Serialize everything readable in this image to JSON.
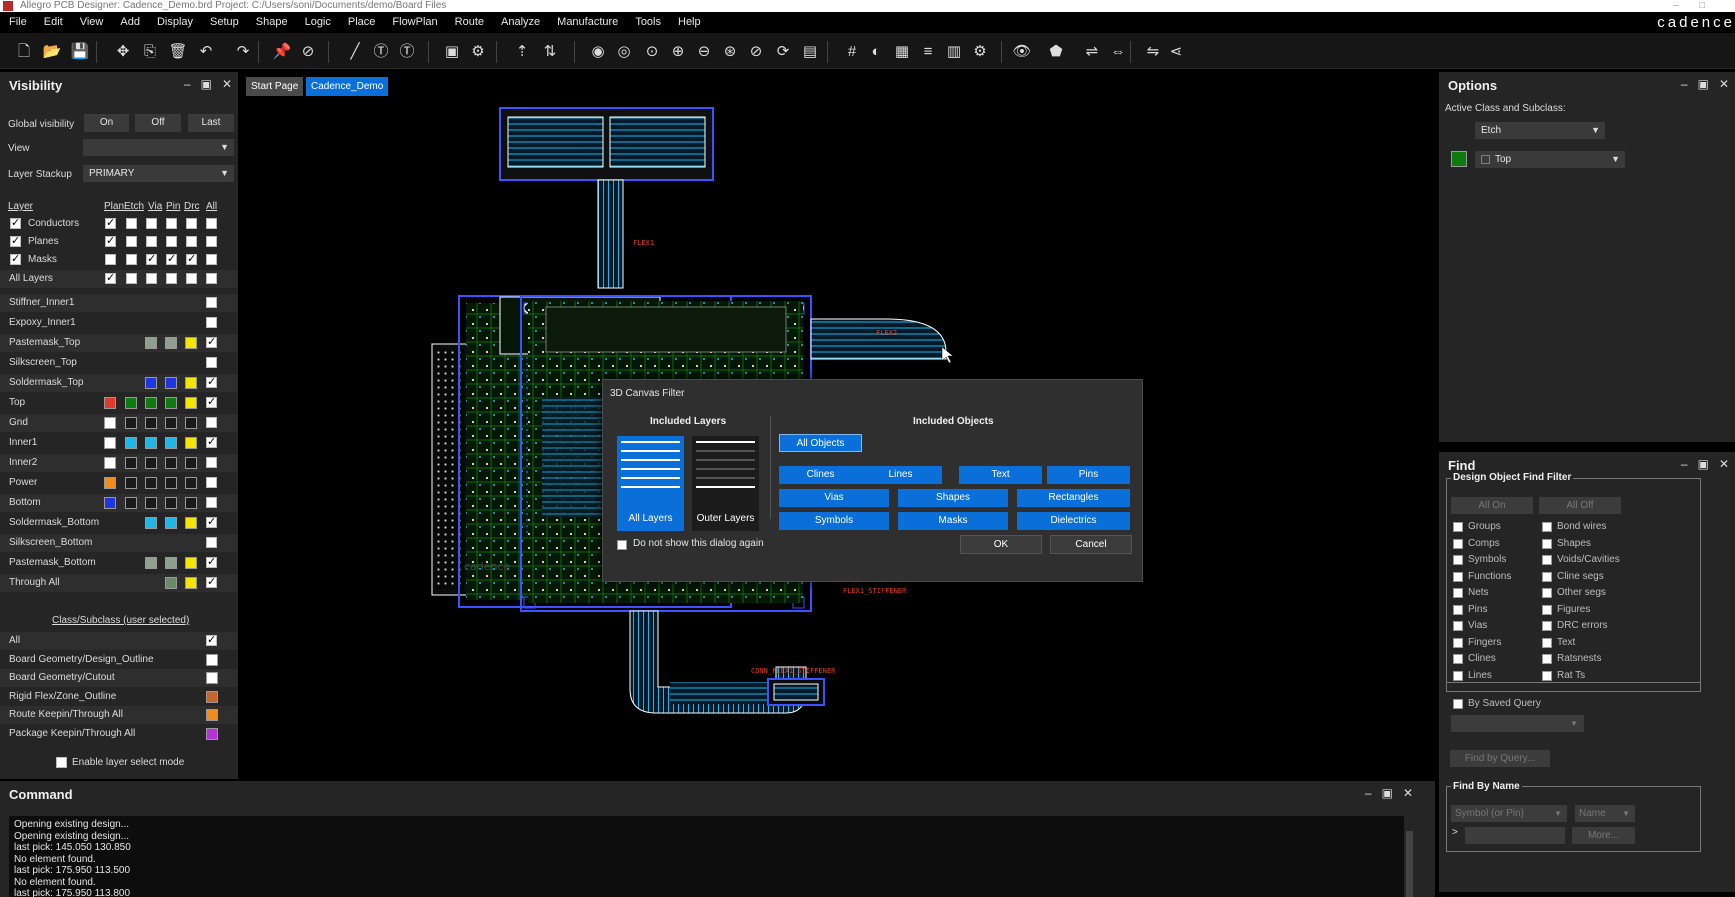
{
  "window": {
    "title": "Allegro PCB Designer: Cadence_Demo.brd  Project: C:/Users/soni/Documents/demo/Board Files",
    "brand": "cadence"
  },
  "menu": [
    "File",
    "Edit",
    "View",
    "Add",
    "Display",
    "Setup",
    "Shape",
    "Logic",
    "Place",
    "FlowPlan",
    "Route",
    "Analyze",
    "Manufacture",
    "Tools",
    "Help"
  ],
  "toolbar": {
    "icons": [
      "new-file-icon",
      "open-folder-icon",
      "save-icon",
      "move-icon",
      "copy-icon",
      "delete-icon",
      "undo-icon",
      "redo-icon",
      "pin-icon",
      "unpin-icon",
      "add-connect-icon",
      "text-icon",
      "edit-text-icon",
      "place-icon",
      "component-icon",
      "slide-icon",
      "spread-icon",
      "drc-icon",
      "color-icon",
      "zoom-fit-icon",
      "zoom-in-icon",
      "zoom-out-icon",
      "zoom-world-icon",
      "zoom-previous-icon",
      "redraw-icon",
      "3d-view-icon",
      "grid-icon",
      "color-wheel-icon",
      "layers-icon",
      "stackup-icon",
      "report-icon",
      "settings-icon",
      "visibility-eye-icon",
      "shape-icon",
      "fanout-icon",
      "measure-icon",
      "flip-icon",
      "share-icon"
    ]
  },
  "visibility": {
    "title": "Visibility",
    "global_label": "Global visibility",
    "global_buttons": [
      "On",
      "Off",
      "Last"
    ],
    "view_label": "View",
    "view_value": "",
    "stackup_label": "Layer Stackup",
    "stackup_value": "PRIMARY",
    "columns": [
      "Layer",
      "Plan",
      "Etch",
      "Via",
      "Pin",
      "Drc",
      "All"
    ],
    "groups": [
      {
        "name": "Conductors",
        "checks": [
          true,
          true,
          false,
          false,
          false,
          false,
          false
        ]
      },
      {
        "name": "Planes",
        "checks": [
          true,
          true,
          false,
          false,
          false,
          false,
          false
        ]
      },
      {
        "name": "Masks",
        "checks": [
          true,
          false,
          false,
          true,
          true,
          true,
          false
        ]
      }
    ],
    "all_layers": {
      "name": "All Layers",
      "checks": [
        true,
        false,
        false,
        false,
        false,
        false
      ]
    },
    "layers": [
      {
        "name": "Stiffner_Inner1",
        "swatches": [],
        "all": false
      },
      {
        "name": "Expoxy_Inner1",
        "swatches": [],
        "all": false
      },
      {
        "name": "Pastemask_Top",
        "swatches": [
          "#8fa08f",
          "#8fa08f",
          "#f5e600"
        ],
        "all": true
      },
      {
        "name": "Silkscreen_Top",
        "swatches": [],
        "all": false
      },
      {
        "name": "Soldermask_Top",
        "swatches": [
          "#1f36e0",
          "#1f36e0",
          "#f5e600"
        ],
        "all": true
      },
      {
        "name": "Top",
        "swatches": [
          "#e03a2a",
          "#0f7a0f",
          "#0f7a0f",
          "#0f7a0f",
          "#f5e600"
        ],
        "all": true
      },
      {
        "name": "Gnd",
        "swatches": [
          "#ffffff",
          "#1a1a1a",
          "#1a1a1a",
          "#1a1a1a",
          "#1a1a1a"
        ],
        "all": false
      },
      {
        "name": "Inner1",
        "swatches": [
          "#ffffff",
          "#21b6e8",
          "#21b6e8",
          "#21b6e8",
          "#f5e600"
        ],
        "all": true
      },
      {
        "name": "Inner2",
        "swatches": [
          "#ffffff",
          "#1a1a1a",
          "#1a1a1a",
          "#1a1a1a",
          "#1a1a1a"
        ],
        "all": false
      },
      {
        "name": "Power",
        "swatches": [
          "#f08b1e",
          "#1a1a1a",
          "#1a1a1a",
          "#1a1a1a",
          "#1a1a1a"
        ],
        "all": false
      },
      {
        "name": "Bottom",
        "swatches": [
          "#1f36e0",
          "#1a1a1a",
          "#1a1a1a",
          "#1a1a1a",
          "#1a1a1a"
        ],
        "all": false
      },
      {
        "name": "Soldermask_Bottom",
        "swatches": [
          "#21b6e8",
          "#21b6e8",
          "#f5e600"
        ],
        "all": true
      },
      {
        "name": "Silkscreen_Bottom",
        "swatches": [],
        "all": false
      },
      {
        "name": "Pastemask_Bottom",
        "swatches": [
          "#8fa08f",
          "#8fa08f",
          "#f5e600"
        ],
        "all": true
      },
      {
        "name": "Through All",
        "swatches": [
          "#6a8a6a",
          "#f5e600"
        ],
        "all": true
      }
    ],
    "class_header": "Class/Subclass (user selected)",
    "class_rows": [
      {
        "name": "All",
        "color": "#ffffff",
        "checked": true
      },
      {
        "name": "Board Geometry/Design_Outline",
        "color": "#ffffff",
        "checked": false
      },
      {
        "name": "Board Geometry/Cutout",
        "color": "#ffffff",
        "checked": false
      },
      {
        "name": "Rigid Flex/Zone_Outline",
        "color": "#c8652a",
        "checked": false
      },
      {
        "name": "Route Keepin/Through All",
        "color": "#f08b1e",
        "checked": false
      },
      {
        "name": "Package Keepin/Through All",
        "color": "#b531d8",
        "checked": false
      }
    ],
    "enable_layer_select": "Enable layer select mode"
  },
  "tabs": [
    "Start Page",
    "Cadence_Demo"
  ],
  "canvas_labels": {
    "flex_top": "FLEX1",
    "flex_right": "FLEX2",
    "stiffener_right": "FLEX1_STIFFENER",
    "conn_stiffener": "CONN_FLEX1_STIFFENER",
    "board_mark": "cadence"
  },
  "dialog": {
    "title": "3D Canvas Filter",
    "layers_header": "Included Layers",
    "objects_header": "Included Objects",
    "tile_all": "All Layers",
    "tile_outer": "Outer Layers",
    "all_objects": "All Objects",
    "object_buttons": [
      "Clines",
      "Lines",
      "Text",
      "Pins",
      "Vias",
      "Shapes",
      "Rectangles",
      "Symbols",
      "Masks",
      "Dielectrics"
    ],
    "dont_show": "Do not show this dialog again",
    "ok": "OK",
    "cancel": "Cancel"
  },
  "options": {
    "title": "Options",
    "active_label": "Active Class and Subclass:",
    "class_value": "Etch",
    "subclass_value": "Top",
    "subclass_color": "#0f7a0f"
  },
  "find": {
    "title": "Find",
    "group_title": "Design Object Find Filter",
    "all_on": "All On",
    "all_off": "All Off",
    "left": [
      "Groups",
      "Comps",
      "Symbols",
      "Functions",
      "Nets",
      "Pins",
      "Vias",
      "Fingers",
      "Clines",
      "Lines"
    ],
    "right": [
      "Bond wires",
      "Shapes",
      "Voids/Cavities",
      "Cline segs",
      "Other segs",
      "Figures",
      "DRC errors",
      "Text",
      "Ratsnests",
      "Rat Ts"
    ],
    "saved_query": "By Saved Query",
    "find_by_query": "Find by Query...",
    "by_name_title": "Find By Name",
    "name_type": "Symbol (or Pin)",
    "name_mode": "Name",
    "more": "More..."
  },
  "command": {
    "title": "Command",
    "lines": [
      "Opening existing design...",
      "Opening existing design...",
      "last pick:  145.050 130.850",
      "No element found.",
      "last pick:  175.950 113.500",
      "No element found.",
      "last pick:  175.950 113.800"
    ]
  }
}
